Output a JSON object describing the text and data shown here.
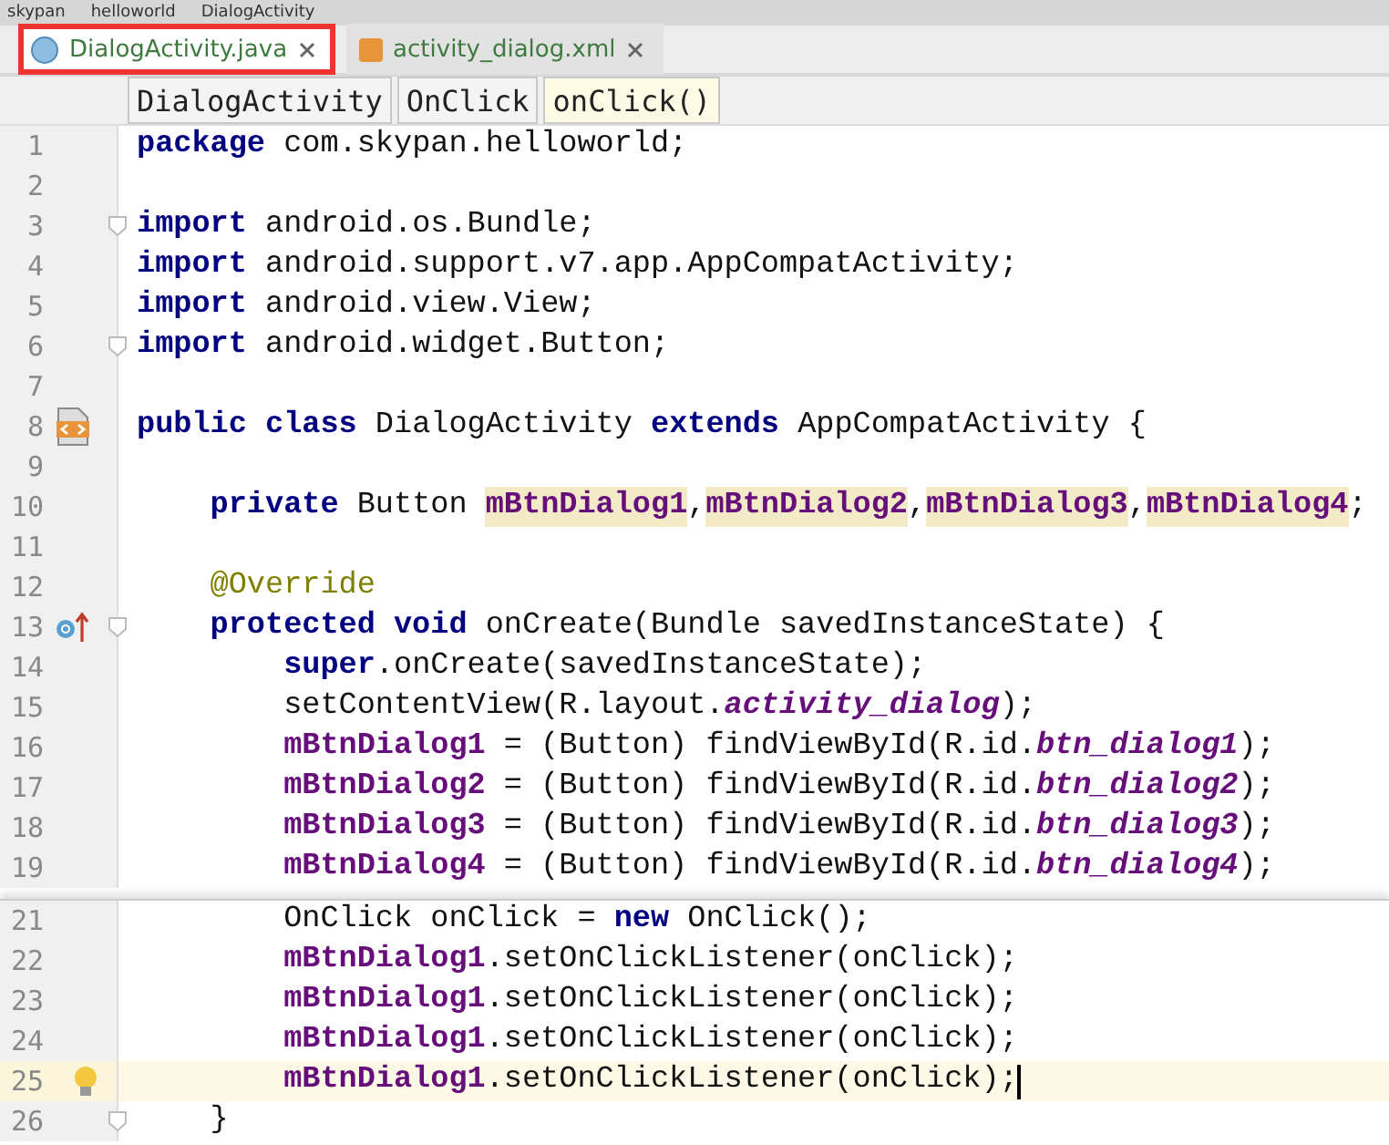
{
  "path": [
    "skypan",
    "helloworld",
    "DialogActivity"
  ],
  "tabs": [
    {
      "label": "DialogActivity.java",
      "kind": "class",
      "selected": true
    },
    {
      "label": "activity_dialog.xml",
      "kind": "layout",
      "selected": false
    }
  ],
  "breadcrumbs": [
    {
      "label": "DialogActivity",
      "selected": false
    },
    {
      "label": "OnClick",
      "selected": false
    },
    {
      "label": "onClick()",
      "selected": true
    }
  ],
  "panes": [
    {
      "lines": [
        {
          "number": "1",
          "kind": "plain",
          "tokens": [
            {
              "text": "package",
              "kind": "kw"
            },
            {
              "text": " com.skypan.helloworld;",
              "kind": "plain"
            }
          ]
        },
        {
          "number": "2",
          "kind": "plain"
        },
        {
          "number": "3",
          "kind": "plain",
          "fold": true,
          "tokens": [
            {
              "text": "import",
              "kind": "kw"
            },
            {
              "text": " android.os.Bundle;",
              "kind": "plain"
            }
          ]
        },
        {
          "number": "4",
          "kind": "plain",
          "tokens": [
            {
              "text": "import",
              "kind": "kw"
            },
            {
              "text": " android.support.v7.app.AppCompatActivity;",
              "kind": "plain"
            }
          ]
        },
        {
          "number": "5",
          "kind": "plain",
          "tokens": [
            {
              "text": "import",
              "kind": "kw"
            },
            {
              "text": " android.view.View;",
              "kind": "plain"
            }
          ]
        },
        {
          "number": "6",
          "kind": "plain",
          "fold": true,
          "tokens": [
            {
              "text": "import",
              "kind": "kw"
            },
            {
              "text": " android.widget.Button;",
              "kind": "plain"
            }
          ]
        },
        {
          "number": "7",
          "kind": "plain"
        },
        {
          "number": "8",
          "kind": "layout",
          "tokens": [
            {
              "text": "public class",
              "kind": "kw"
            },
            {
              "text": " DialogActivity ",
              "kind": "plain"
            },
            {
              "text": "extends",
              "kind": "kw"
            },
            {
              "text": " AppCompatActivity {",
              "kind": "plain"
            }
          ]
        },
        {
          "number": "9",
          "kind": "plain"
        },
        {
          "number": "10",
          "kind": "plain",
          "tokens": [
            {
              "text": "    private",
              "kind": "kw"
            },
            {
              "text": " Button ",
              "kind": "plain"
            },
            {
              "text": "mBtnDialog1",
              "kind": "field-hl"
            },
            {
              "text": ",",
              "kind": "plain"
            },
            {
              "text": "mBtnDialog2",
              "kind": "field-hl"
            },
            {
              "text": ",",
              "kind": "plain"
            },
            {
              "text": "mBtnDialog3",
              "kind": "field-hl"
            },
            {
              "text": ",",
              "kind": "plain"
            },
            {
              "text": "mBtnDialog4",
              "kind": "field-hl"
            },
            {
              "text": ";",
              "kind": "plain"
            }
          ]
        },
        {
          "number": "11",
          "kind": "plain"
        },
        {
          "number": "12",
          "kind": "plain",
          "tokens": [
            {
              "text": "    @Override",
              "kind": "annotation"
            }
          ]
        },
        {
          "number": "13",
          "kind": "override",
          "fold": true,
          "tokens": [
            {
              "text": "    protected void",
              "kind": "kw"
            },
            {
              "text": " onCreate(Bundle savedInstanceState) {",
              "kind": "plain"
            }
          ]
        },
        {
          "number": "14",
          "kind": "plain",
          "tokens": [
            {
              "text": "        super",
              "kind": "kw"
            },
            {
              "text": ".onCreate(savedInstanceState);",
              "kind": "plain"
            }
          ]
        },
        {
          "number": "15",
          "kind": "plain",
          "tokens": [
            {
              "text": "        setContentView(R.layout.",
              "kind": "plain"
            },
            {
              "text": "activity_dialog",
              "kind": "static"
            },
            {
              "text": ");",
              "kind": "plain"
            }
          ]
        },
        {
          "number": "16",
          "kind": "plain",
          "tokens": [
            {
              "text": "        mBtnDialog1",
              "kind": "field"
            },
            {
              "text": " = (Button) findViewById(R.id.",
              "kind": "plain"
            },
            {
              "text": "btn_dialog1",
              "kind": "static"
            },
            {
              "text": ");",
              "kind": "plain"
            }
          ]
        },
        {
          "number": "17",
          "kind": "plain",
          "tokens": [
            {
              "text": "        mBtnDialog2",
              "kind": "field"
            },
            {
              "text": " = (Button) findViewById(R.id.",
              "kind": "plain"
            },
            {
              "text": "btn_dialog2",
              "kind": "static"
            },
            {
              "text": ");",
              "kind": "plain"
            }
          ]
        },
        {
          "number": "18",
          "kind": "plain",
          "tokens": [
            {
              "text": "        mBtnDialog3",
              "kind": "field"
            },
            {
              "text": " = (Button) findViewById(R.id.",
              "kind": "plain"
            },
            {
              "text": "btn_dialog3",
              "kind": "static"
            },
            {
              "text": ");",
              "kind": "plain"
            }
          ]
        },
        {
          "number": "19",
          "kind": "plain",
          "tokens": [
            {
              "text": "        mBtnDialog4",
              "kind": "field"
            },
            {
              "text": " = (Button) findViewById(R.id.",
              "kind": "plain"
            },
            {
              "text": "btn_dialog4",
              "kind": "static"
            },
            {
              "text": ");",
              "kind": "plain"
            }
          ]
        }
      ]
    },
    {
      "lines": [
        {
          "number": "21",
          "kind": "plain",
          "tokens": [
            {
              "text": "        OnClick onClick = ",
              "kind": "plain"
            },
            {
              "text": "new",
              "kind": "kw"
            },
            {
              "text": " OnClick();",
              "kind": "plain"
            }
          ]
        },
        {
          "number": "22",
          "kind": "plain",
          "tokens": [
            {
              "text": "        mBtnDialog1",
              "kind": "field"
            },
            {
              "text": ".setOnClickListener(onClick);",
              "kind": "plain"
            }
          ]
        },
        {
          "number": "23",
          "kind": "plain",
          "tokens": [
            {
              "text": "        mBtnDialog1",
              "kind": "field"
            },
            {
              "text": ".setOnClickListener(onClick);",
              "kind": "plain"
            }
          ]
        },
        {
          "number": "24",
          "kind": "plain",
          "tokens": [
            {
              "text": "        mBtnDialog1",
              "kind": "field"
            },
            {
              "text": ".setOnClickListener(onClick);",
              "kind": "plain"
            }
          ]
        },
        {
          "number": "25",
          "kind": "bulb",
          "current": true,
          "tokens": [
            {
              "text": "        mBtnDialog1",
              "kind": "field"
            },
            {
              "text": ".setOnClickListener(onClick);",
              "kind": "plain"
            }
          ]
        },
        {
          "number": "26",
          "kind": "plain",
          "fold": true,
          "tokens": [
            {
              "text": "    }",
              "kind": "plain"
            }
          ]
        }
      ]
    }
  ]
}
